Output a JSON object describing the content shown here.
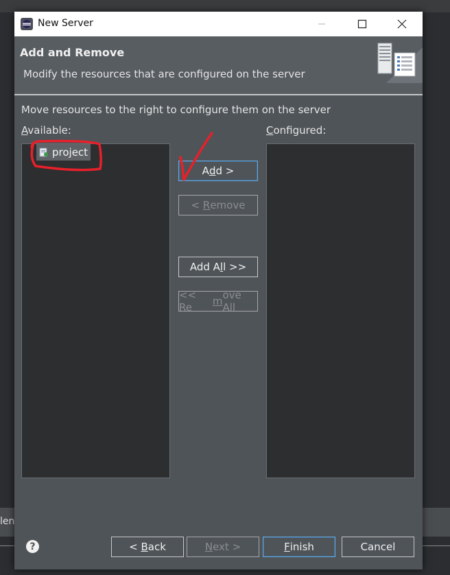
{
  "window": {
    "title": "New Server"
  },
  "header": {
    "title": "Add and Remove",
    "description": "Modify the resources that are configured on the server"
  },
  "instruction": "Move resources to the right to configure them on the server",
  "available": {
    "label_mnemonic": "A",
    "label_rest": "vailable:",
    "items": [
      {
        "label": "project",
        "icon": "project-icon"
      }
    ]
  },
  "configured": {
    "label_mnemonic": "C",
    "label_rest": "onfigured:",
    "items": []
  },
  "transfer_buttons": {
    "add": {
      "pre": "A",
      "mn": "d",
      "post": "d >"
    },
    "remove": {
      "pre": "< ",
      "mn": "R",
      "post": "emove"
    },
    "add_all": {
      "pre": "Add A",
      "mn": "l",
      "post": "l >>"
    },
    "remove_all": {
      "pre": "<< Re",
      "mn": "m",
      "post": "ove All"
    }
  },
  "footer": {
    "help_symbol": "?",
    "back": {
      "pre": "< ",
      "mn": "B",
      "post": "ack"
    },
    "next": {
      "pre": "",
      "mn": "N",
      "post": "ext >"
    },
    "finish": {
      "pre": "",
      "mn": "F",
      "post": "inish"
    },
    "cancel": "Cancel"
  },
  "background": {
    "left_text": "len"
  },
  "colors": {
    "annotation_red": "#e8202a",
    "dialog_bg": "#4f5458",
    "header_bg": "#585d62"
  }
}
